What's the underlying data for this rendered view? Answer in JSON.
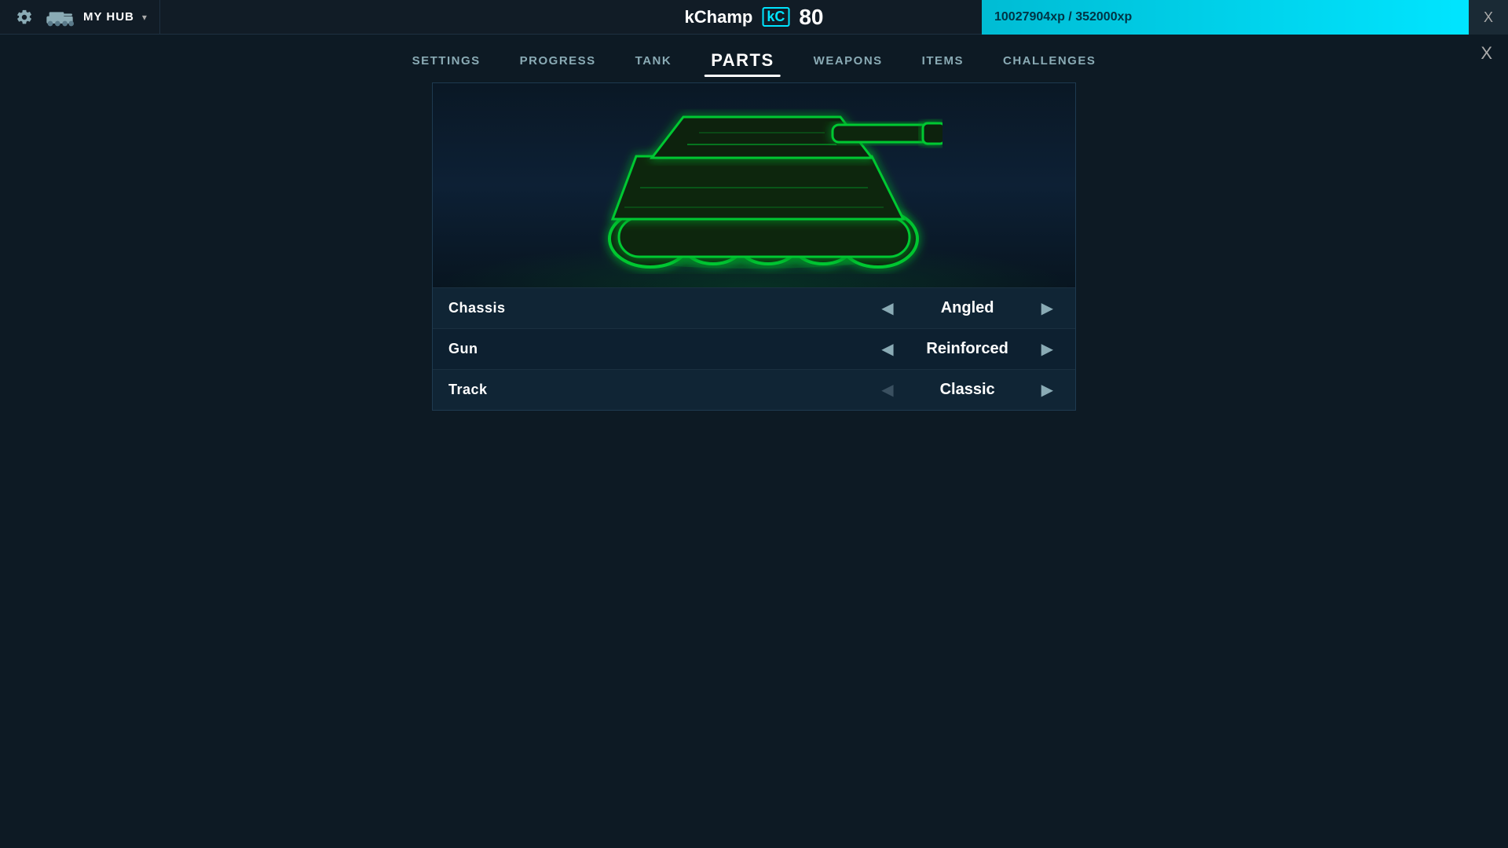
{
  "topbar": {
    "hub_label": "MY HUB",
    "username": "kChamp",
    "kc_logo": "kC",
    "level": "80",
    "xp_current": "10027904xp",
    "xp_max": "352000xp",
    "xp_display": "10027904xp / 352000xp",
    "close_label": "X"
  },
  "nav": {
    "items": [
      {
        "label": "SETTINGS",
        "active": false
      },
      {
        "label": "PROGRESS",
        "active": false
      },
      {
        "label": "TANK",
        "active": false
      },
      {
        "label": "PARTS",
        "active": true
      },
      {
        "label": "WEAPONS",
        "active": false
      },
      {
        "label": "ITEMS",
        "active": false
      },
      {
        "label": "CHALLENGES",
        "active": false
      }
    ]
  },
  "parts": {
    "rows": [
      {
        "label": "Chassis",
        "value": "Angled",
        "left_disabled": false,
        "right_disabled": false
      },
      {
        "label": "Gun",
        "value": "Reinforced",
        "left_disabled": false,
        "right_disabled": false
      },
      {
        "label": "Track",
        "value": "Classic",
        "left_disabled": true,
        "right_disabled": false
      }
    ]
  }
}
